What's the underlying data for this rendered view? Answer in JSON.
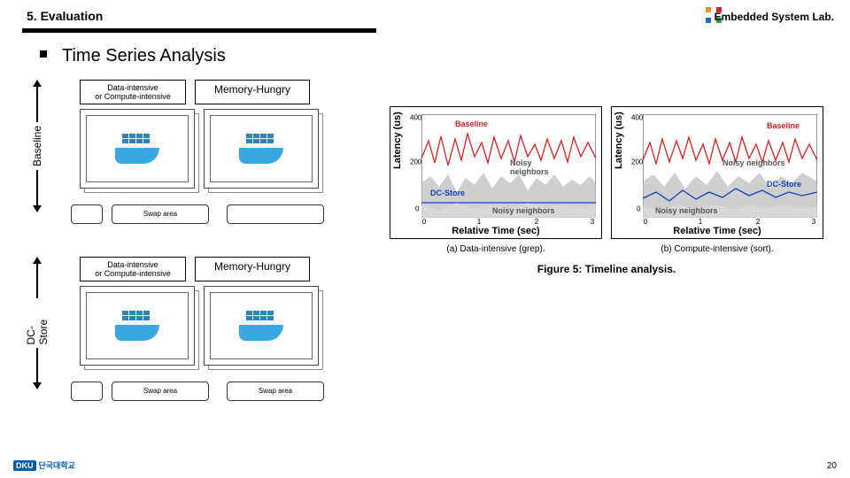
{
  "header": {
    "section_title": "5. Evaluation",
    "lab_name": "Embedded System Lab."
  },
  "main_title": "Time Series Analysis",
  "labels": {
    "data_intensive": "Data-intensive\nor Compute-intensive",
    "memory_hungry": "Memory-Hungry",
    "baseline": "Baseline",
    "dc_store": "DC-Store",
    "swap_area": "Swap area"
  },
  "charts": {
    "ylabel": "Latency (us)",
    "xlabel": "Relative Time (sec)",
    "caption_a": "(a) Data-intensive (grep).",
    "caption_b": "(b) Compute-intensive (sort).",
    "figure_title": "Figure 5: Timeline analysis.",
    "legend_baseline": "Baseline",
    "legend_noisy": "Noisy neighbors",
    "legend_dcstore": "DC-Store"
  },
  "footer": {
    "university": "단국대학교",
    "page": "20"
  },
  "chart_data": [
    {
      "type": "line",
      "title": "(a) Data-intensive (grep)",
      "xlabel": "Relative Time (sec)",
      "ylabel": "Latency (us)",
      "xlim": [
        0,
        3
      ],
      "ylim": [
        0,
        450
      ],
      "x_ticks": [
        0,
        1,
        2,
        3
      ],
      "y_ticks": [
        0,
        200,
        400
      ],
      "series": [
        {
          "name": "Baseline",
          "color": "#d92020",
          "approx_mean": 240,
          "approx_range": [
            150,
            420
          ],
          "pattern": "noisy-high"
        },
        {
          "name": "Noisy neighbors (baseline)",
          "color": "#999999",
          "approx_mean": 120,
          "approx_range": [
            70,
            190
          ],
          "pattern": "noisy-low-fill"
        },
        {
          "name": "DC-Store",
          "color": "#1040c0",
          "approx_mean": 60,
          "approx_range": [
            40,
            80
          ],
          "pattern": "flat-low"
        },
        {
          "name": "Noisy neighbors (dc-store)",
          "color": "#bbbbbb",
          "approx_mean": 55,
          "approx_range": [
            30,
            90
          ],
          "pattern": "flat-low-fill"
        }
      ]
    },
    {
      "type": "line",
      "title": "(b) Compute-intensive (sort)",
      "xlabel": "Relative Time (sec)",
      "ylabel": "Latency (us)",
      "xlim": [
        0,
        3
      ],
      "ylim": [
        0,
        450
      ],
      "x_ticks": [
        0,
        1,
        2,
        3
      ],
      "y_ticks": [
        0,
        200,
        400
      ],
      "series": [
        {
          "name": "Baseline",
          "color": "#d92020",
          "approx_mean": 230,
          "approx_range": [
            150,
            400
          ],
          "pattern": "noisy-high"
        },
        {
          "name": "Noisy neighbors (baseline)",
          "color": "#999999",
          "approx_mean": 130,
          "approx_range": [
            80,
            200
          ],
          "pattern": "noisy-low-fill"
        },
        {
          "name": "DC-Store",
          "color": "#1040c0",
          "approx_mean": 90,
          "approx_range": [
            60,
            140
          ],
          "pattern": "wavy-low"
        },
        {
          "name": "Noisy neighbors (dc-store)",
          "color": "#bbbbbb",
          "approx_mean": 55,
          "approx_range": [
            30,
            90
          ],
          "pattern": "flat-low-fill"
        }
      ]
    }
  ]
}
